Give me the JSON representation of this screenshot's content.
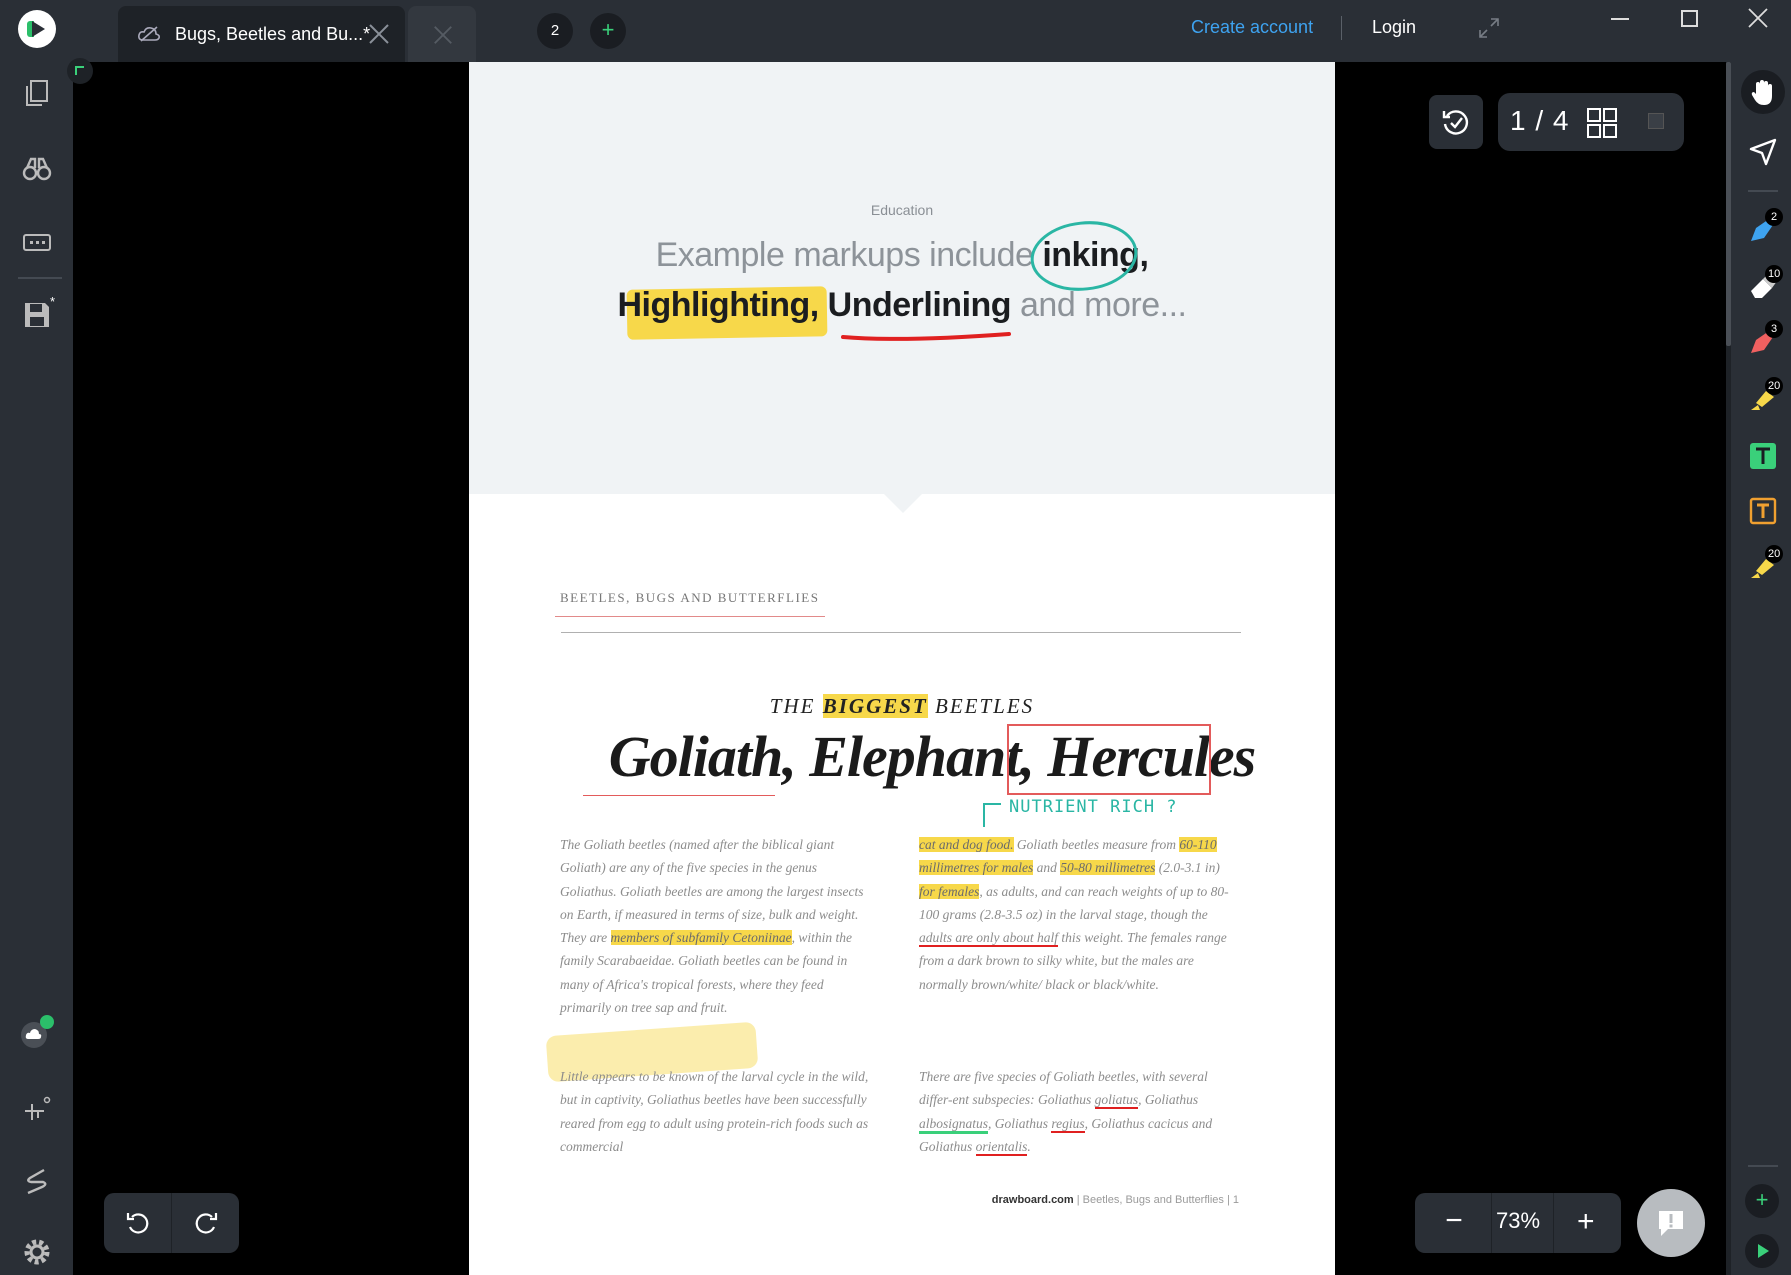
{
  "titlebar": {
    "tab_label": "Bugs, Beetles and Bu...*",
    "tab_count": "2",
    "add_tab_label": "+",
    "create_account": "Create account",
    "login": "Login"
  },
  "left_toolbar": {
    "icons": [
      "pages-icon",
      "binoculars-icon",
      "keyboard-icon",
      "save-icon",
      "cloud-sync-icon",
      "ruler-icon",
      "signature-icon",
      "settings-icon"
    ],
    "save_badge": "*"
  },
  "right_toolbar": {
    "tools": [
      {
        "name": "hand-tool-icon",
        "badge": ""
      },
      {
        "name": "select-tool-icon",
        "badge": ""
      },
      {
        "name": "pen-blue-icon",
        "badge": "2",
        "color": "#3ea3f0"
      },
      {
        "name": "eraser-icon",
        "badge": "10",
        "color": "#ffffff"
      },
      {
        "name": "pen-red-icon",
        "badge": "3",
        "color": "#f06060"
      },
      {
        "name": "highlighter-yellow-icon",
        "badge": "20",
        "color": "#f7d84a"
      },
      {
        "name": "text-green-icon",
        "badge": "",
        "color": "#3ad07a"
      },
      {
        "name": "text-orange-icon",
        "badge": "",
        "color": "#f0a030"
      },
      {
        "name": "highlighter-yellow-2-icon",
        "badge": "20",
        "color": "#f7d84a"
      }
    ],
    "add_label": "+"
  },
  "document": {
    "category": "Education",
    "headline_part1": "Example markups include ",
    "headline_bold1": "inking,",
    "headline_bold2": "Highlighting,",
    "headline_bold3": "Underlining",
    "headline_part2": " and more...",
    "section_label": "BEETLES, BUGS AND BUTTERFLIES",
    "kicker_pre": "THE ",
    "kicker_mark": "BIGGEST",
    "kicker_post": " BEETLES",
    "title": "Goliath, Elephant, Hercules",
    "handwritten_note": "NUTRIENT RICH ?",
    "col1_a": "The Goliath beetles (named after the biblical giant Goliath) are any of the five species in the genus Goliathus. Goliath beetles are among the largest insects on Earth, if measured in terms of size, bulk and weight. They are ",
    "col1_mark": "members of subfamily Cetoniinae",
    "col1_b": ", within the family Scarabaeidae. Goliath beetles can be found in many of Africa's tropical forests, where they feed primarily on tree sap and fruit.",
    "col2": "Little appears to be known of the larval cycle in the wild, but in captivity, Goliathus beetles have been successfully reared from egg to adult using protein-rich foods such as commercial",
    "col3_mark1": "cat and dog food.",
    "col3_a": " Goliath beetles measure from ",
    "col3_mark2": "60-110 millimetres for males",
    "col3_b": " and ",
    "col3_mark3": "50-80 millimetres",
    "col3_c": " (2.0-3.1 in) ",
    "col3_mark4": "for females",
    "col3_d": ", as adults, and can reach weights of up to 80-100 grams (2.8-3.5 oz) in the larval stage, though the ",
    "col3_red": "adults are only about half",
    "col3_e": " this weight. The females range from a dark brown to silky white, but the males are normally brown/white/ black or black/white.",
    "col4_a": "There are five species of Goliath beetles, with several differ-ent subspecies: Goliathus ",
    "col4_r1": "goliatus",
    "col4_b": ", Goliathus ",
    "col4_g1": "albosignatus",
    "col4_c": ", Goliathus ",
    "col4_r2": "regius",
    "col4_d": ", Goliathus cacicus and Goliathus ",
    "col4_r3": "orientalis",
    "col4_e": ".",
    "footer_site": "drawboard.com",
    "footer_rest": "  |   Beetles, Bugs and Butterflies   |   1"
  },
  "pager": {
    "text": "1 / 4"
  },
  "zoom": {
    "value": "73%",
    "minus": "−",
    "plus": "+"
  },
  "colors": {
    "accent": "#3ea3f0",
    "brand_green": "#3ad07a",
    "highlight": "#f7d84a",
    "ink_red": "#e02020",
    "ink_teal": "#2ab6a4"
  }
}
